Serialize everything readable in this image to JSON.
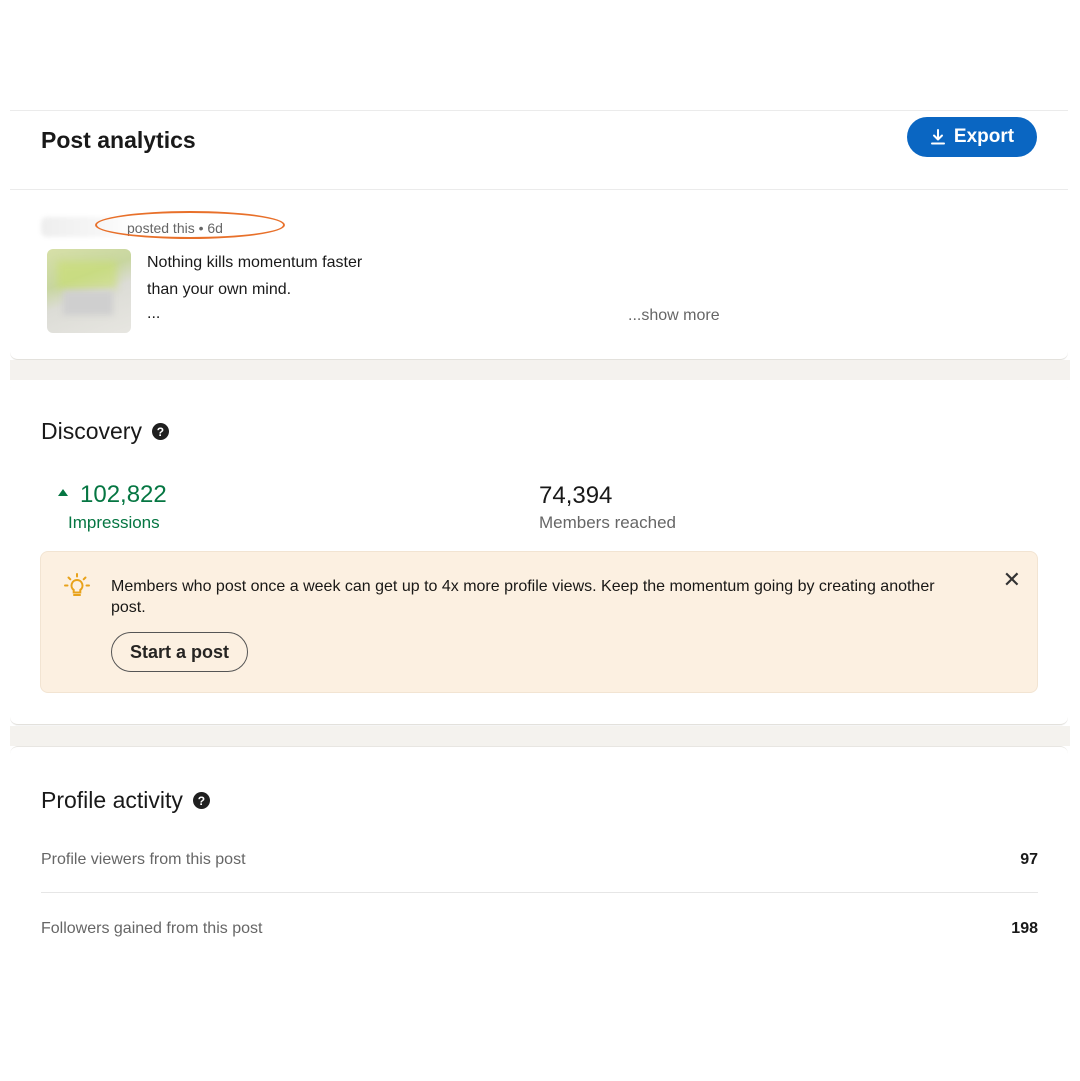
{
  "header": {
    "title": "Post analytics",
    "export_label": "Export",
    "export_icon": "download-icon"
  },
  "post": {
    "meta": "posted this • 6d",
    "text_line1": "Nothing kills momentum faster",
    "text_line2": "than your own mind.",
    "ellipsis": "...",
    "show_more": "...show more"
  },
  "discovery": {
    "title": "Discovery",
    "impressions_value": "102,822",
    "impressions_label": "Impressions",
    "reached_value": "74,394",
    "reached_label": "Members reached",
    "tip_text": "Members who post once a week can get up to 4x more profile views. Keep the momentum going by creating another post.",
    "start_post_label": "Start a post",
    "close_symbol": "✕"
  },
  "profile_activity": {
    "title": "Profile activity",
    "rows": [
      {
        "label": "Profile viewers from this post",
        "value": "97"
      },
      {
        "label": "Followers gained from this post",
        "value": "198"
      }
    ]
  },
  "colors": {
    "accent_blue": "#0a66c2",
    "positive_green": "#057642",
    "tip_background": "#fcf0e1",
    "highlight_orange": "#e8702a"
  }
}
